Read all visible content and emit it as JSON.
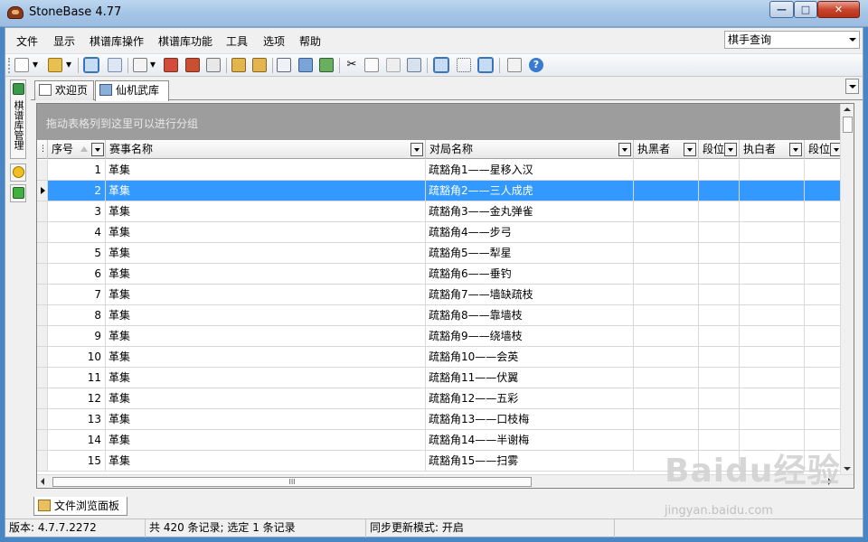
{
  "window": {
    "title": "StoneBase 4.77"
  },
  "menu": {
    "items": [
      "文件",
      "显示",
      "棋谱库操作",
      "棋谱库功能",
      "工具",
      "选项",
      "帮助"
    ]
  },
  "quick_select": {
    "value": "棋手查询"
  },
  "left_dock": {
    "label": "棋谱库管理"
  },
  "doc_tabs": [
    {
      "label": "欢迎页",
      "icon": "home-icon"
    },
    {
      "label": "仙机武库",
      "icon": "database-icon"
    }
  ],
  "grid": {
    "group_hint": "拖动表格列到这里可以进行分组",
    "columns": [
      "序号",
      "赛事名称",
      "对局名称",
      "执黑者",
      "段位",
      "执白者",
      "段位"
    ],
    "rows": [
      {
        "no": "1",
        "event": "革集",
        "game": "疏豁角1——星移入汉",
        "black": "",
        "brank": "",
        "white": "",
        "wrank": ""
      },
      {
        "no": "2",
        "event": "革集",
        "game": "疏豁角2——三人成虎",
        "black": "",
        "brank": "",
        "white": "",
        "wrank": "",
        "selected": true
      },
      {
        "no": "3",
        "event": "革集",
        "game": "疏豁角3——金丸弹雀",
        "black": "",
        "brank": "",
        "white": "",
        "wrank": ""
      },
      {
        "no": "4",
        "event": "革集",
        "game": "疏豁角4——步弓",
        "black": "",
        "brank": "",
        "white": "",
        "wrank": ""
      },
      {
        "no": "5",
        "event": "革集",
        "game": "疏豁角5——犁星",
        "black": "",
        "brank": "",
        "white": "",
        "wrank": ""
      },
      {
        "no": "6",
        "event": "革集",
        "game": "疏豁角6——垂钓",
        "black": "",
        "brank": "",
        "white": "",
        "wrank": ""
      },
      {
        "no": "7",
        "event": "革集",
        "game": "疏豁角7——墙缺疏枝",
        "black": "",
        "brank": "",
        "white": "",
        "wrank": ""
      },
      {
        "no": "8",
        "event": "革集",
        "game": "疏豁角8——靠墙枝",
        "black": "",
        "brank": "",
        "white": "",
        "wrank": ""
      },
      {
        "no": "9",
        "event": "革集",
        "game": "疏豁角9——绕墙枝",
        "black": "",
        "brank": "",
        "white": "",
        "wrank": ""
      },
      {
        "no": "10",
        "event": "革集",
        "game": "疏豁角10——会英",
        "black": "",
        "brank": "",
        "white": "",
        "wrank": ""
      },
      {
        "no": "11",
        "event": "革集",
        "game": "疏豁角11——伏翼",
        "black": "",
        "brank": "",
        "white": "",
        "wrank": ""
      },
      {
        "no": "12",
        "event": "革集",
        "game": "疏豁角12——五彩",
        "black": "",
        "brank": "",
        "white": "",
        "wrank": ""
      },
      {
        "no": "13",
        "event": "革集",
        "game": "疏豁角13——口枝梅",
        "black": "",
        "brank": "",
        "white": "",
        "wrank": ""
      },
      {
        "no": "14",
        "event": "革集",
        "game": "疏豁角14——半谢梅",
        "black": "",
        "brank": "",
        "white": "",
        "wrank": ""
      },
      {
        "no": "15",
        "event": "革集",
        "game": "疏豁角15——扫雾",
        "black": "",
        "brank": "",
        "white": "",
        "wrank": ""
      }
    ],
    "hscroll_grip": "III"
  },
  "bottom_tab": {
    "label": "文件浏览面板"
  },
  "status": {
    "version": "版本: 4.7.7.2272",
    "records": "共 420 条记录; 选定 1 条记录",
    "sync": "同步更新模式: 开启"
  },
  "watermark": {
    "brand": "Baidu经验",
    "url": "jingyan.baidu.com"
  },
  "colors": {
    "selection": "#3399ff",
    "group_panel": "#9d9d9d",
    "title_gradient": "#a5c5e6"
  }
}
